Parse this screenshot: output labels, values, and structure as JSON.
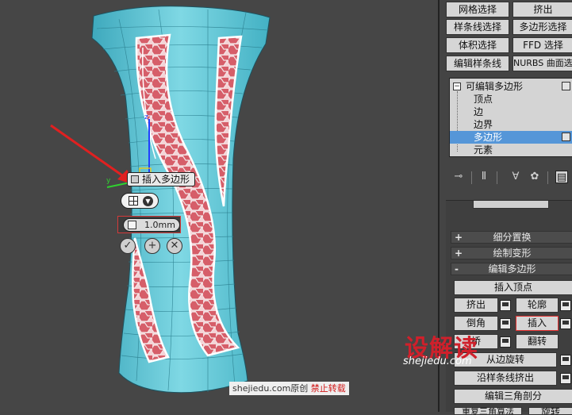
{
  "viewport": {
    "caddy_label": "插入多边形",
    "caddy_value": "1.0mm",
    "caddy_ok_icon": "checkmark-icon",
    "caddy_apply_icon": "plus-icon",
    "caddy_cancel_icon": "cancel-icon",
    "watermark_site": "shejiedu.com原创",
    "watermark_notice": "禁止转载"
  },
  "selection_buttons": [
    "网格选择",
    "挤出",
    "样条线选择",
    "多边形选择",
    "体积选择",
    "FFD 选择",
    "编辑样条线",
    "NURBS 曲面选择"
  ],
  "stack": {
    "object": "可编辑多边形",
    "items": [
      "顶点",
      "边",
      "边界",
      "多边形",
      "元素"
    ],
    "selected": "多边形"
  },
  "toolbar_icons": [
    "pin-stack-icon",
    "show-end-result-icon",
    "make-unique-icon",
    "remove-modifier-icon",
    "configure-sets-icon"
  ],
  "rollouts": {
    "subdivision_displacement": "细分置换",
    "paint_deformation": "绘制变形",
    "edit_polygons": "编辑多边形",
    "collapsed_sign": "+",
    "expanded_sign": "-"
  },
  "edit_polygons": {
    "insert_vertex": "插入顶点",
    "extrude": "挤出",
    "outline": "轮廓",
    "bevel": "倒角",
    "inset": "插入",
    "bridge": "桥",
    "flip": "翻转",
    "hinge_from_edge": "从边旋转",
    "extrude_along_spline": "沿样条线挤出",
    "edit_triangulation": "编辑三角剖分",
    "retriangulate_partial": "重复三角算法",
    "rotate_partial": "旋转"
  },
  "brand": {
    "logo": "设解读",
    "url": "shejiedu.com"
  },
  "colors": {
    "model_cyan": "#5fc6d6",
    "inset_pink": "#d9606a",
    "selection_blue": "#5596d8",
    "highlight_red": "#e23030"
  }
}
